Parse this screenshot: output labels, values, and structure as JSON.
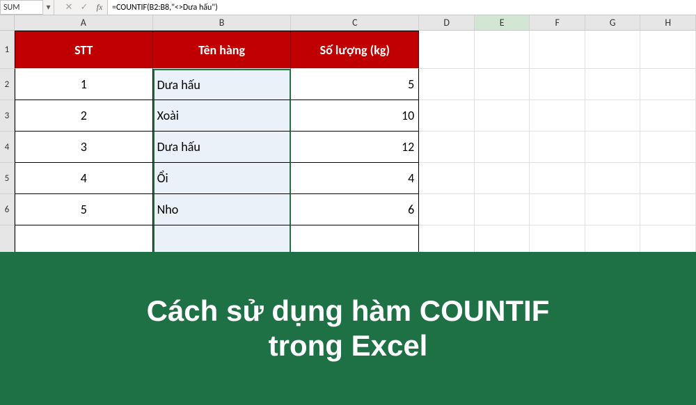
{
  "formula_bar": {
    "name_box_value": "SUM",
    "cancel_icon": "✕",
    "enter_icon": "✓",
    "fx_label": "fx",
    "formula": "=COUNTIF(B2:B8,\"<>Dưa hấu\")"
  },
  "columns": [
    "A",
    "B",
    "C",
    "D",
    "E",
    "F",
    "G",
    "H"
  ],
  "row_numbers": [
    "1",
    "2",
    "3",
    "4",
    "5",
    "6"
  ],
  "table": {
    "headers": {
      "a": "STT",
      "b": "Tên hàng",
      "c": "Số lượng (kg)"
    },
    "rows": [
      {
        "stt": "1",
        "name": "Dưa hấu",
        "qty": "5"
      },
      {
        "stt": "2",
        "name": "Xoài",
        "qty": "10"
      },
      {
        "stt": "3",
        "name": "Dưa hấu",
        "qty": "12"
      },
      {
        "stt": "4",
        "name": "Ổi",
        "qty": "4"
      },
      {
        "stt": "5",
        "name": "Nho",
        "qty": "6"
      }
    ]
  },
  "banner": {
    "line1": "Cách sử dụng hàm COUNTIF",
    "line2": "trong Excel"
  }
}
